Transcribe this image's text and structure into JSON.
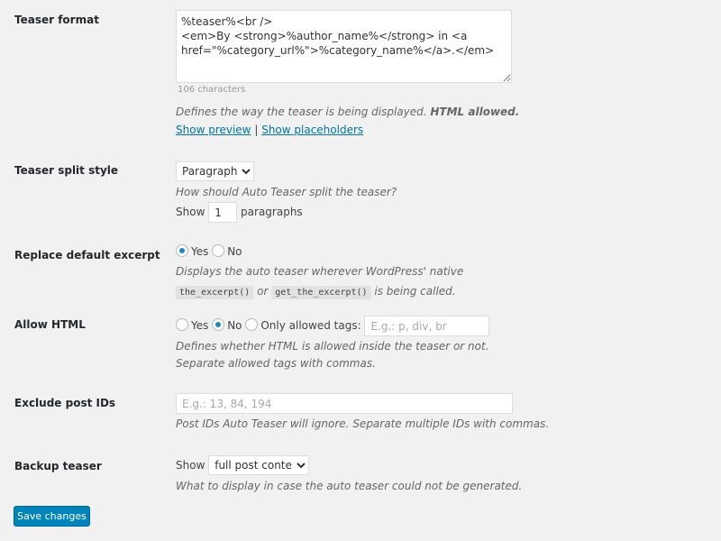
{
  "teaser_format": {
    "label": "Teaser format",
    "value": "%teaser%<br />\n<em>By <strong>%author_name%</strong> in <a href=\"%category_url%\">%category_name%</a>.</em>",
    "char_count": "106 characters",
    "desc": "Defines the way the teaser is being displayed.",
    "desc_bold": "HTML allowed.",
    "show_preview": "Show preview",
    "separator": "|",
    "show_placeholders": "Show placeholders"
  },
  "split_style": {
    "label": "Teaser split style",
    "selected": "Paragraphs",
    "desc": "How should Auto Teaser split the teaser?",
    "show": "Show",
    "count": "1",
    "unit": "paragraphs"
  },
  "replace_excerpt": {
    "label": "Replace default excerpt",
    "yes": "Yes",
    "no": "No",
    "desc1": "Displays the auto teaser wherever WordPress' native",
    "code1": "the_excerpt()",
    "desc_or": "or",
    "code2": "get_the_excerpt()",
    "desc2": "is being called."
  },
  "allow_html": {
    "label": "Allow HTML",
    "yes": "Yes",
    "no": "No",
    "only": "Only allowed tags:",
    "placeholder": "E.g.: p, div, br",
    "desc": "Defines whether HTML is allowed inside the teaser or not. Separate allowed tags with commas."
  },
  "exclude": {
    "label": "Exclude post IDs",
    "placeholder": "E.g.: 13, 84, 194",
    "desc": "Post IDs Auto Teaser will ignore. Separate multiple IDs with commas."
  },
  "backup": {
    "label": "Backup teaser",
    "show": "Show",
    "selected": "full post content",
    "desc": "What to display in case the auto teaser could not be generated."
  },
  "save": "Save changes"
}
